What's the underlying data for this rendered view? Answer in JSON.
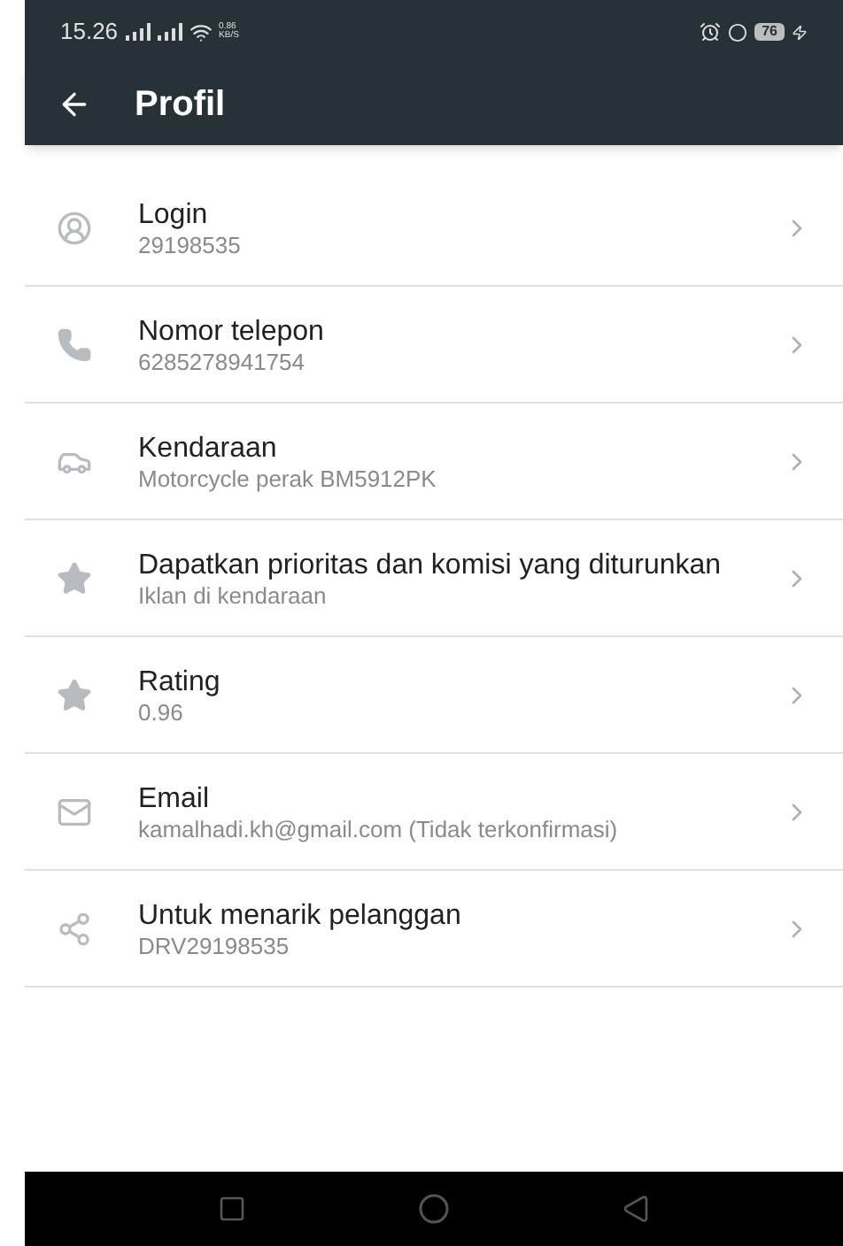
{
  "status_bar": {
    "time": "15.26",
    "speed_value": "0.86",
    "speed_unit": "KB/S",
    "battery": "76"
  },
  "app_bar": {
    "title": "Profil"
  },
  "items": [
    {
      "kind": "user",
      "title": "Login",
      "subtitle": "29198535"
    },
    {
      "kind": "phone",
      "title": "Nomor telepon",
      "subtitle": "6285278941754"
    },
    {
      "kind": "car",
      "title": "Kendaraan",
      "subtitle": "Motorcycle perak BM5912PK"
    },
    {
      "kind": "star",
      "title": "Dapatkan prioritas dan komisi yang diturunkan",
      "subtitle": "Iklan di kendaraan"
    },
    {
      "kind": "star",
      "title": "Rating",
      "subtitle": "0.96"
    },
    {
      "kind": "mail",
      "title": "Email",
      "subtitle": "kamalhadi.kh@gmail.com (Tidak terkonfirmasi)"
    },
    {
      "kind": "share",
      "title": "Untuk menarik pelanggan",
      "subtitle": "DRV29198535"
    }
  ]
}
